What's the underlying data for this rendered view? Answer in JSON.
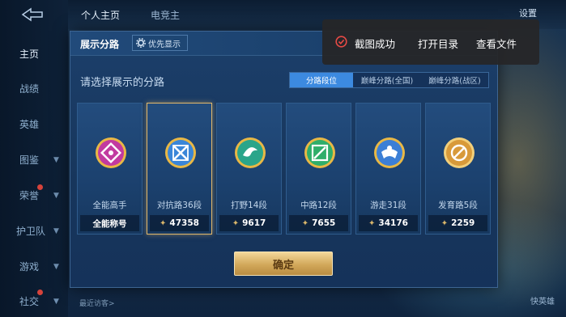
{
  "nav": {
    "items": [
      {
        "label": "主页",
        "active": true
      },
      {
        "label": "战绩"
      },
      {
        "label": "英雄"
      },
      {
        "label": "图鉴"
      },
      {
        "label": "荣誉"
      },
      {
        "label": "护卫队"
      },
      {
        "label": "游戏"
      },
      {
        "label": "社交"
      }
    ]
  },
  "topbar": {
    "tabs": [
      "个人主页",
      "电竞主"
    ],
    "settings": "设置"
  },
  "dialog": {
    "title": "展示分路",
    "priority_label": "优先显示",
    "subtitle": "请选择展示的分路",
    "segments": [
      "分路段位",
      "巅峰分路(全国)",
      "巅峰分路(战区)"
    ],
    "active_segment": 0,
    "cards": [
      {
        "name": "全能高手",
        "stat": "全能称号",
        "show_star": false,
        "color": "#c23aa0"
      },
      {
        "name": "对抗路36段",
        "stat": "47358",
        "show_star": true,
        "color": "#3a86d8",
        "selected": true
      },
      {
        "name": "打野14段",
        "stat": "9617",
        "show_star": true,
        "color": "#2aa58a"
      },
      {
        "name": "中路12段",
        "stat": "7655",
        "show_star": true,
        "color": "#2fae6a"
      },
      {
        "name": "游走31段",
        "stat": "34176",
        "show_star": true,
        "color": "#3c7fd6"
      },
      {
        "name": "发育路5段",
        "stat": "2259",
        "show_star": true,
        "color": "#d89a3a"
      }
    ],
    "confirm_label": "确定"
  },
  "toast": {
    "message": "截图成功",
    "open_dir": "打开目录",
    "view_file": "查看文件"
  },
  "footer": {
    "visitor": "最近访客>",
    "hero": "快英雄"
  },
  "colors": {
    "accent": "#3c8ae0",
    "gold": "#e2b86a",
    "error_icon": "#e84a45"
  }
}
